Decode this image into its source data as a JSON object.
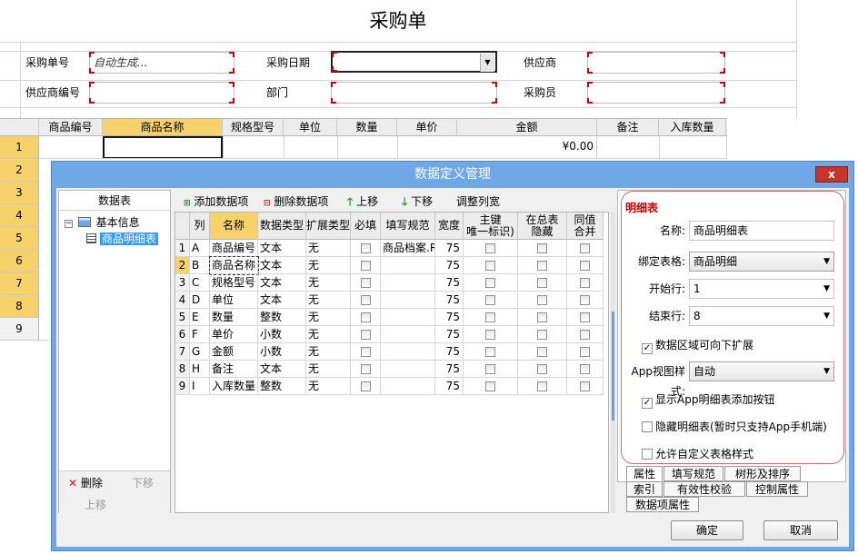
{
  "form": {
    "title": "采购单",
    "fields": [
      {
        "label": "采购单号",
        "value": "自动生成..."
      },
      {
        "label": "采购日期",
        "value": ""
      },
      {
        "label": "供应商",
        "value": ""
      },
      {
        "label": "供应商编号",
        "value": ""
      },
      {
        "label": "部门",
        "value": ""
      },
      {
        "label": "采购员",
        "value": ""
      }
    ],
    "columns": [
      "商品编号",
      "商品名称",
      "规格型号",
      "单位",
      "数量",
      "单价",
      "金额",
      "备注",
      "入库数量"
    ],
    "rows": [
      "1",
      "2",
      "3",
      "4",
      "5",
      "6",
      "7",
      "8",
      "9"
    ],
    "first_row_amount": "¥0.00"
  },
  "dialog": {
    "title": "数据定义管理",
    "close": "x",
    "tree": {
      "header": "数据表",
      "root": "基本信息",
      "child": "商品明细表",
      "delete": "删除",
      "move_down": "下移",
      "move_up": "上移"
    },
    "toolbar": {
      "add": "添加数据项",
      "remove": "删除数据项",
      "up": "上移",
      "down": "下移",
      "adjust": "调整列宽"
    },
    "grid": {
      "headers": [
        "列",
        "名称",
        "数据类型",
        "扩展类型",
        "必填",
        "填写规范",
        "宽度",
        "主键\n唯一标识)",
        "在总表\n隐藏",
        "同值\n合并"
      ],
      "rows": [
        {
          "n": "1",
          "col": "A",
          "name": "商品编号",
          "type": "文本",
          "ext": "无",
          "rule": "商品档案.R",
          "width": "75"
        },
        {
          "n": "2",
          "col": "B",
          "name": "商品名称",
          "type": "文本",
          "ext": "无",
          "rule": "",
          "width": "75"
        },
        {
          "n": "3",
          "col": "C",
          "name": "规格型号",
          "type": "文本",
          "ext": "无",
          "rule": "",
          "width": "75"
        },
        {
          "n": "4",
          "col": "D",
          "name": "单位",
          "type": "文本",
          "ext": "无",
          "rule": "",
          "width": "75"
        },
        {
          "n": "5",
          "col": "E",
          "name": "数量",
          "type": "整数",
          "ext": "无",
          "rule": "",
          "width": "75"
        },
        {
          "n": "6",
          "col": "F",
          "name": "单价",
          "type": "小数",
          "ext": "无",
          "rule": "",
          "width": "75"
        },
        {
          "n": "7",
          "col": "G",
          "name": "金额",
          "type": "小数",
          "ext": "无",
          "rule": "",
          "width": "75"
        },
        {
          "n": "8",
          "col": "H",
          "name": "备注",
          "type": "文本",
          "ext": "无",
          "rule": "",
          "width": "75"
        },
        {
          "n": "9",
          "col": "I",
          "name": "入库数量",
          "type": "整数",
          "ext": "无",
          "rule": "",
          "width": "75"
        }
      ]
    },
    "props": {
      "section": "明细表",
      "name_label": "名称:",
      "name_value": "商品明细表",
      "bind_label": "绑定表格:",
      "bind_value": "商品明细",
      "start_label": "开始行:",
      "start_value": "1",
      "end_label": "结束行:",
      "end_value": "8",
      "expand_label": "数据区域可向下扩展",
      "app_style_label": "App视图样式:",
      "app_style_value": "自动",
      "show_add_label": "显示App明细表添加按钮",
      "hide_label": "隐藏明细表(暂时只支持App手机端)",
      "allow_custom_label": "允许自定义表格样式"
    },
    "tabs": {
      "row1": [
        "属性",
        "填写规范",
        "树形及排序"
      ],
      "row2": [
        "索引",
        "有效性校验",
        "控制属性"
      ],
      "row3": [
        "数据项属性"
      ]
    },
    "ok": "确定",
    "cancel": "取消"
  }
}
